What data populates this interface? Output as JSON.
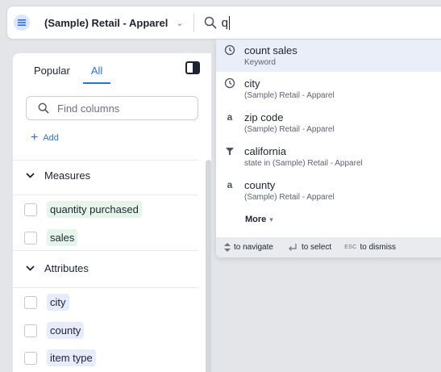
{
  "searchbar": {
    "datasource_name": "(Sample) Retail - Apparel",
    "query": "q"
  },
  "panel": {
    "tabs": [
      {
        "label": "Popular",
        "active": false
      },
      {
        "label": "All",
        "active": true
      }
    ],
    "find_placeholder": "Find columns",
    "add_label": "Add",
    "sections": {
      "measures": {
        "title": "Measures",
        "items": [
          "quantity purchased",
          "sales"
        ]
      },
      "attributes": {
        "title": "Attributes",
        "items": [
          "city",
          "county",
          "item type"
        ]
      }
    }
  },
  "suggestions": [
    {
      "title": "count sales",
      "subtitle": "Keyword",
      "icon": "history-icon"
    },
    {
      "title": "city",
      "subtitle": "(Sample) Retail - Apparel",
      "icon": "history-icon"
    },
    {
      "title": "zip code",
      "subtitle": "(Sample) Retail - Apparel",
      "icon": "text-attribute-icon"
    },
    {
      "title": "california",
      "subtitle": "state in (Sample) Retail - Apparel",
      "icon": "filter-icon"
    },
    {
      "title": "county",
      "subtitle": "(Sample) Retail - Apparel",
      "icon": "text-attribute-icon"
    }
  ],
  "dropdown": {
    "more_label": "More",
    "footer": {
      "navigate": "to navigate",
      "select": "to select",
      "esc_key": "ESC",
      "dismiss": "to dismiss"
    }
  },
  "colors": {
    "accent": "#2770ef",
    "measure_chip": "#e4f6ec",
    "attribute_chip": "#e6ecfb",
    "active_row": "#e9eef9"
  }
}
